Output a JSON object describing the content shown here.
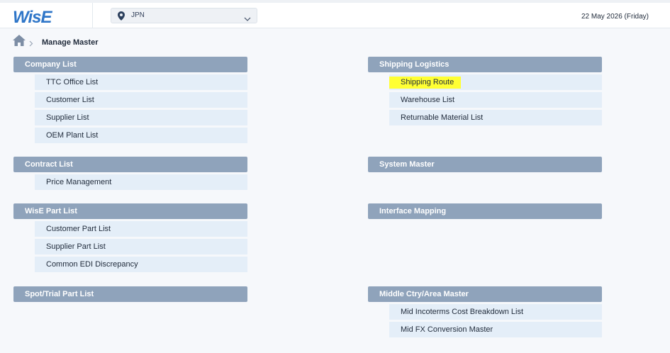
{
  "header": {
    "logo": "WisE",
    "country": "JPN",
    "date": "22 May 2026 (Friday)"
  },
  "breadcrumb": {
    "title": "Manage Master"
  },
  "sections": {
    "company": {
      "title": "Company List",
      "items": [
        "TTC Office List",
        "Customer List",
        "Supplier List",
        "OEM Plant List"
      ]
    },
    "contract": {
      "title": "Contract List",
      "items": [
        "Price Management"
      ]
    },
    "wise_part": {
      "title": "WisE Part List",
      "items": [
        "Customer Part List",
        "Supplier Part List",
        "Common EDI Discrepancy"
      ]
    },
    "spot": {
      "title": "Spot/Trial Part List"
    },
    "shipping": {
      "title": "Shipping Logistics",
      "items": [
        "Shipping Route",
        "Warehouse List",
        "Returnable Material List"
      ]
    },
    "system": {
      "title": "System Master"
    },
    "interface": {
      "title": "Interface Mapping"
    },
    "middle": {
      "title": "Middle Ctry/Area Master",
      "items": [
        "Mid Incoterms Cost Breakdown List",
        "Mid FX Conversion Master"
      ]
    }
  },
  "colors": {
    "section_header": "#8fa3bb",
    "item_bg": "#e4eef8",
    "highlight": "#ffff33",
    "logo": "#2f76c8"
  }
}
